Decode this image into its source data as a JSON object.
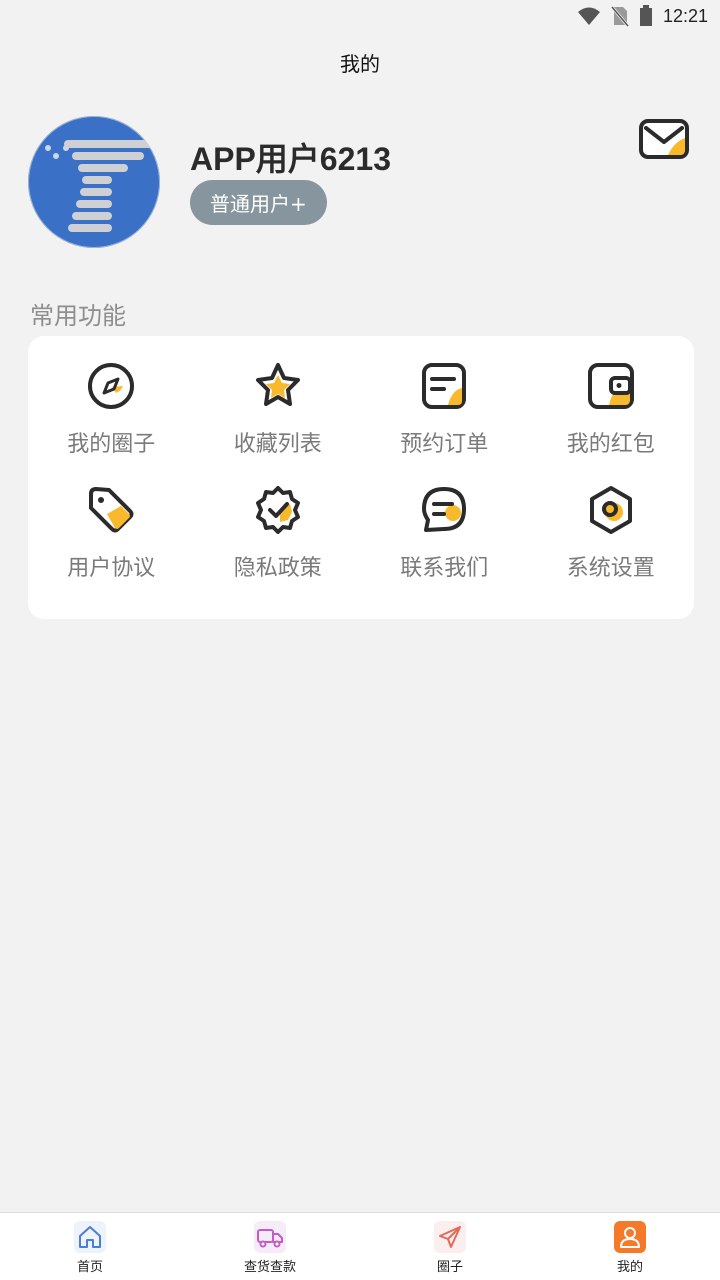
{
  "status_bar": {
    "time": "12:21"
  },
  "header": {
    "title": "我的"
  },
  "profile": {
    "username": "APP用户6213",
    "level": "普通用户+"
  },
  "section": {
    "title": "常用功能"
  },
  "functions": [
    {
      "label": "我的圈子",
      "icon": "compass-icon"
    },
    {
      "label": "收藏列表",
      "icon": "star-icon"
    },
    {
      "label": "预约订单",
      "icon": "note-icon"
    },
    {
      "label": "我的红包",
      "icon": "wallet-icon"
    },
    {
      "label": "用户协议",
      "icon": "tag-icon"
    },
    {
      "label": "隐私政策",
      "icon": "badge-check-icon"
    },
    {
      "label": "联系我们",
      "icon": "chat-icon"
    },
    {
      "label": "系统设置",
      "icon": "settings-hexagon-icon"
    }
  ],
  "tabbar": [
    {
      "label": "首页",
      "icon": "home-icon"
    },
    {
      "label": "查货查款",
      "icon": "truck-icon"
    },
    {
      "label": "圈子",
      "icon": "paper-plane-icon"
    },
    {
      "label": "我的",
      "icon": "user-icon"
    }
  ],
  "colors": {
    "accent": "#f9b92c",
    "stroke": "#2b2b2b",
    "avatar": "#3a70c6",
    "badge": "#87959f",
    "active_tab": "#f47a2a"
  }
}
